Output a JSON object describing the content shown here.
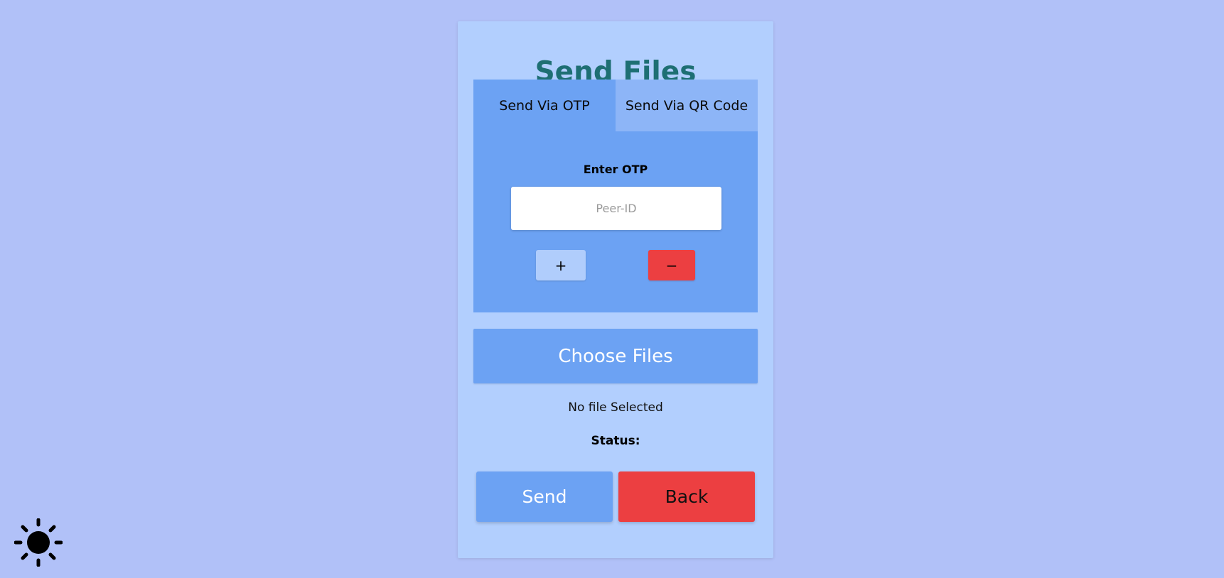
{
  "header": {
    "title": "Send Files"
  },
  "tabs": [
    {
      "label": "Send Via OTP",
      "active": true
    },
    {
      "label": "Send Via QR Code",
      "active": false
    }
  ],
  "otp": {
    "label": "Enter OTP",
    "placeholder": "Peer-ID",
    "value": "",
    "add_label": "+",
    "remove_label": "−"
  },
  "file_picker": {
    "button_label": "Choose Files",
    "selection_text": "No file Selected"
  },
  "status": {
    "label": "Status:"
  },
  "actions": {
    "send_label": "Send",
    "back_label": "Back"
  },
  "theme_toggle": {
    "icon": "sun-icon"
  },
  "colors": {
    "background": "#b1c1f8",
    "card": "#b2cffe",
    "panel": "#6ca2f3",
    "inactive_tab": "#8db5f7",
    "title": "#1e6f73",
    "danger": "#ec3f41"
  }
}
